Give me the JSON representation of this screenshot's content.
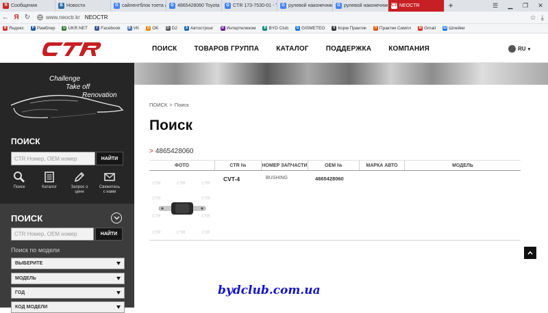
{
  "browser": {
    "tabs": [
      {
        "label": "Сообщения",
        "fav": "Я",
        "color": "#c62828"
      },
      {
        "label": "Новости",
        "fav": "В",
        "color": "#2f6ea8"
      },
      {
        "label": "сайлентблок тоета авенсис",
        "fav": "G",
        "color": "#4285f4"
      },
      {
        "label": "4865428060 Toyota",
        "fav": "G",
        "color": "#4285f4"
      },
      {
        "label": "CTR 173-7530-01 - T",
        "fav": "G",
        "color": "#4285f4"
      },
      {
        "label": "рулевой наконечник",
        "fav": "G",
        "color": "#4285f4"
      },
      {
        "label": "рулевой наконечник",
        "fav": "G",
        "color": "#4285f4"
      },
      {
        "label": "NEOCTR",
        "fav": "CTR",
        "color": "#c61f24",
        "active": true
      }
    ],
    "new_tab": "+",
    "url": "www.neoctr.kr",
    "page_title": "NEOCTR",
    "back": "←",
    "refresh": "↻",
    "bookmarks": [
      {
        "label": "Яндекс",
        "fav": "Я",
        "color": "#d32f2f"
      },
      {
        "label": "Рамблер",
        "fav": "Р",
        "color": "#1e5aa8"
      },
      {
        "label": "UKR.NET",
        "fav": "U",
        "color": "#2e7d32"
      },
      {
        "label": "Facebook",
        "fav": "f",
        "color": "#3b5998"
      },
      {
        "label": "VK",
        "fav": "В",
        "color": "#4a76a8"
      },
      {
        "label": "OK",
        "fav": "О",
        "color": "#ee8208"
      },
      {
        "label": "D2",
        "fav": "D",
        "color": "#555555"
      },
      {
        "label": "Автостронг",
        "fav": "S",
        "color": "#1565c0"
      },
      {
        "label": "Интертелеком",
        "fav": "И",
        "color": "#6a1b9a"
      },
      {
        "label": "BYD Club",
        "fav": "B",
        "color": "#00897b"
      },
      {
        "label": "GISMETEO",
        "fav": "G",
        "color": "#1976d2"
      },
      {
        "label": "Корм Практик",
        "fav": "К",
        "color": "#333333"
      },
      {
        "label": "Практик Симпл",
        "fav": "П",
        "color": "#e65100"
      },
      {
        "label": "Gmail",
        "fav": "M",
        "color": "#d93025"
      },
      {
        "label": "Шлейки",
        "fav": "Ш",
        "color": "#1a73e8"
      }
    ]
  },
  "header": {
    "logo": "CTR",
    "nav": [
      "ПОИСК",
      "ТОВАРОВ ГРУППА",
      "КАТАЛОГ",
      "ПОДДЕРЖКА",
      "КОМПАНИЯ"
    ],
    "lang": "RU"
  },
  "sidebar": {
    "slogan": [
      "Challenge",
      "Take off",
      "Renovation"
    ],
    "search1": {
      "title": "ПОИСК",
      "placeholder": "CTR Номер, OEM номер",
      "button": "НАЙТИ"
    },
    "quick": [
      {
        "label": "Поиск",
        "icon": "magnifier-icon"
      },
      {
        "label": "Каталог",
        "icon": "catalog-icon"
      },
      {
        "label": "Запрос о цене",
        "icon": "pencil-icon"
      },
      {
        "label": "Свяжитесь с нами",
        "icon": "envelope-icon"
      }
    ],
    "search2": {
      "title": "ПОИСК",
      "placeholder": "CTR Номер, OEM номер",
      "button": "НАЙТИ"
    },
    "model_label": "Поиск по модели",
    "selects": [
      "ВЫБЕРИТЕ",
      "МОДЕЛЬ",
      "ГОД",
      "КОД МОДЕЛИ"
    ]
  },
  "content": {
    "breadcrumb": {
      "root": "ПОИСК",
      "sep": ">",
      "current": "Поиск"
    },
    "title": "Поиск",
    "query_prefix": ">",
    "query": "4865428060",
    "columns": [
      "ФОТО",
      "CTR №",
      "НОМЕР ЗАПЧАСТИ",
      "OEM №",
      "МАРКА АВТО",
      "МОДЕЛЬ"
    ],
    "rows": [
      {
        "ctr": "CVT-4",
        "part": "BUSHING",
        "oem": "4865428060",
        "brand": "",
        "model": ""
      }
    ],
    "photo_watermark": "CTR"
  },
  "watermark": "bydclub.com.ua",
  "colors": {
    "brand": "#c61f24",
    "sidebar_dark": "#262626",
    "sidebar_gray": "#3c3c3c",
    "watermark": "#1414c8"
  }
}
